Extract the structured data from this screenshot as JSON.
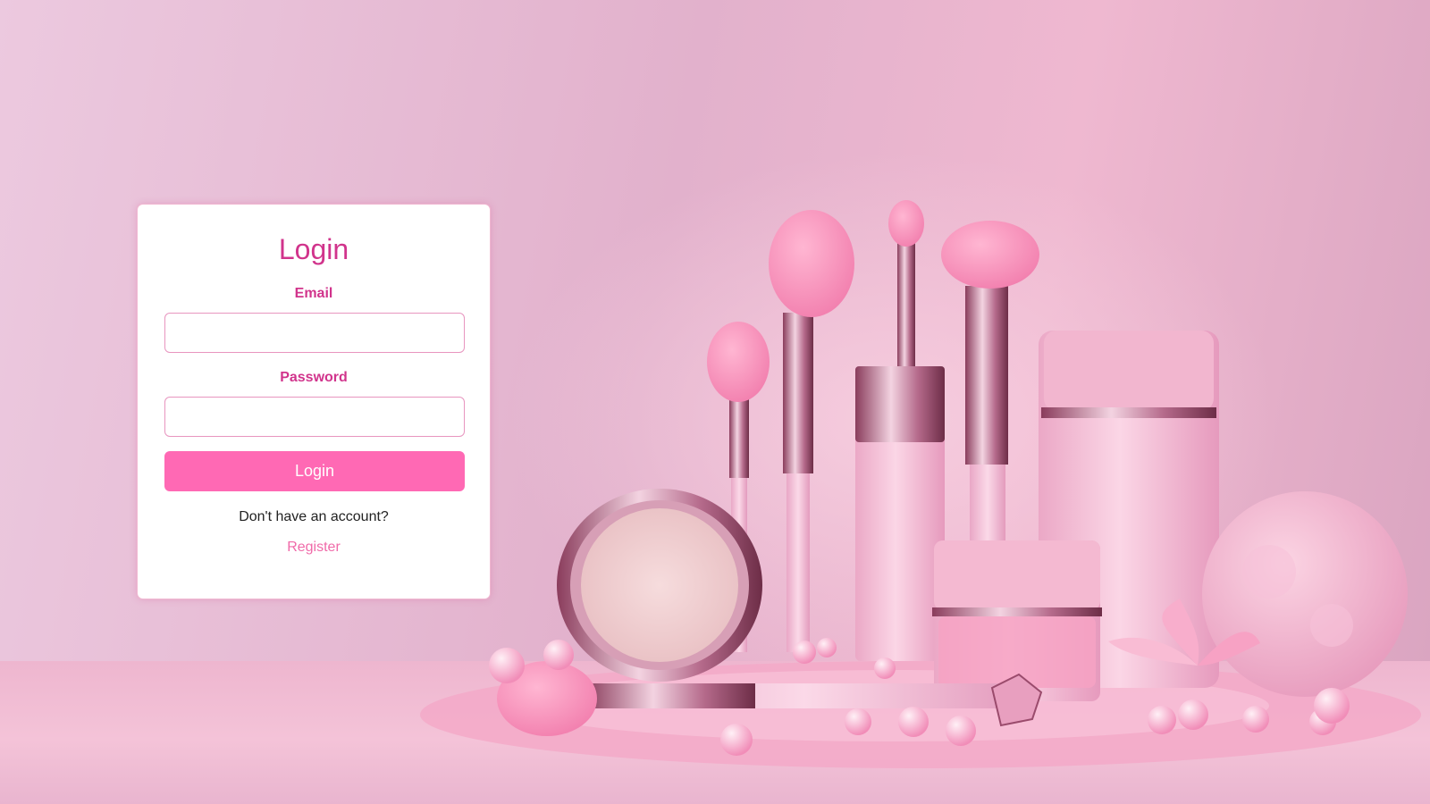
{
  "login": {
    "title": "Login",
    "email_label": "Email",
    "email_value": "",
    "email_placeholder": "",
    "password_label": "Password",
    "password_value": "",
    "password_placeholder": "",
    "submit_label": "Login",
    "no_account_text": "Don't have an account?",
    "register_link": "Register"
  },
  "colors": {
    "accent": "#d1348c",
    "button": "#ff69b4",
    "link": "#f06aa9",
    "background": "#e8b7d0"
  },
  "icons": {
    "background_illustration": "cosmetics-illustration"
  }
}
